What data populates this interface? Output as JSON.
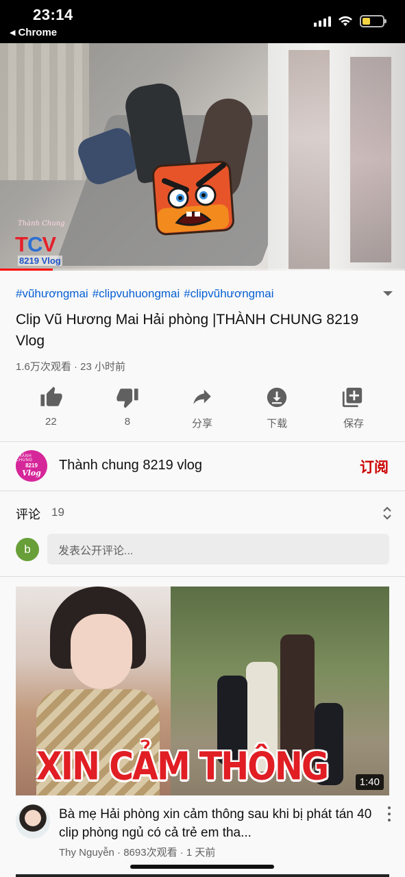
{
  "status_bar": {
    "time": "23:14",
    "back_label": "Chrome",
    "back_glyph": "◀"
  },
  "player": {
    "logo_script": "Thành Chung",
    "logo_t": "T",
    "logo_c": "C",
    "logo_v": "V",
    "logo_sub": "8219 Vlog",
    "progress_fraction": 0.13
  },
  "video": {
    "hashtags": [
      "#vũhươngmai",
      "#clipvuhuongmai",
      "#clipvũhươngmai"
    ],
    "title": "Clip Vũ Hương Mai Hải phòng |THÀNH CHUNG 8219 Vlog",
    "meta": "1.6万次观看 · 23 小时前"
  },
  "actions": {
    "like_count": "22",
    "dislike_count": "8",
    "share_label": "分享",
    "download_label": "下载",
    "save_label": "保存"
  },
  "channel": {
    "avatar_top": "THÀNH CHUNG",
    "avatar_num": "8219",
    "avatar_vlog": "Vlog",
    "name": "Thành chung 8219 vlog",
    "subscribe_label": "订阅",
    "subscribe_color": "#cc0000"
  },
  "comments": {
    "heading": "评论",
    "count": "19",
    "user_initial": "b",
    "placeholder": "发表公开评论..."
  },
  "recommended": {
    "thumb_text": "XIN CẢM THÔNG",
    "duration": "1:40",
    "title": "Bà mẹ Hải phòng xin cảm thông sau khi bị phát tán 40 clip phòng ngủ có cả trẻ em tha...",
    "meta": "Thy Nguyễn · 8693次观看 · 1 天前"
  },
  "colors": {
    "link": "#065fd4",
    "progress": "#ff0000",
    "user_avatar": "#689f38",
    "channel_avatar": "#d6279a"
  }
}
